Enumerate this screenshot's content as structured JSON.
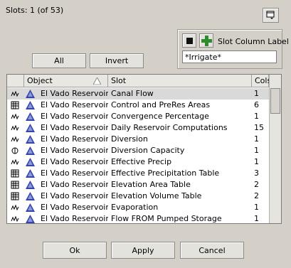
{
  "header": {
    "slots_label": "Slots: 1 (of 53)"
  },
  "toolbar": {
    "all_label": "All",
    "invert_label": "Invert"
  },
  "slot_column": {
    "label": "Slot Column Label",
    "value": "*Irrigate*"
  },
  "table": {
    "columns": [
      "Object",
      "Slot",
      "Cols"
    ],
    "rows": [
      {
        "icon": "series-slot-icon",
        "object": "El Vado Reservoir",
        "slot": "Canal Flow",
        "cols": "1",
        "selected": true
      },
      {
        "icon": "table-slot-icon",
        "object": "El Vado Reservoir",
        "slot": "Control and PreRes Areas",
        "cols": "6"
      },
      {
        "icon": "series-slot-icon",
        "object": "El Vado Reservoir",
        "slot": "Convergence Percentage",
        "cols": "1"
      },
      {
        "icon": "series-slot-icon",
        "object": "El Vado Reservoir",
        "slot": "Daily Reservoir Computations",
        "cols": "15"
      },
      {
        "icon": "series-slot-icon",
        "object": "El Vado Reservoir",
        "slot": "Diversion",
        "cols": "1"
      },
      {
        "icon": "agg-slot-icon",
        "object": "El Vado Reservoir",
        "slot": "Diversion Capacity",
        "cols": "1"
      },
      {
        "icon": "series-slot-icon",
        "object": "El Vado Reservoir",
        "slot": "Effective Precip",
        "cols": "1"
      },
      {
        "icon": "table-slot-icon",
        "object": "El Vado Reservoir",
        "slot": "Effective Precipitation Table",
        "cols": "3"
      },
      {
        "icon": "table-slot-icon",
        "object": "El Vado Reservoir",
        "slot": "Elevation Area Table",
        "cols": "2"
      },
      {
        "icon": "table-slot-icon",
        "object": "El Vado Reservoir",
        "slot": "Elevation Volume Table",
        "cols": "2"
      },
      {
        "icon": "series-slot-icon",
        "object": "El Vado Reservoir",
        "slot": "Evaporation",
        "cols": "1"
      },
      {
        "icon": "series-slot-icon",
        "object": "El Vado Reservoir",
        "slot": "Flow FROM Pumped Storage",
        "cols": "1"
      }
    ]
  },
  "footer": {
    "ok_label": "Ok",
    "apply_label": "Apply",
    "cancel_label": "Cancel"
  },
  "colors": {
    "background": "#d4d0c8",
    "selected_row": "#d9d9d9",
    "object_icon": "#3344aa",
    "add_icon": "#2e8b2e"
  }
}
